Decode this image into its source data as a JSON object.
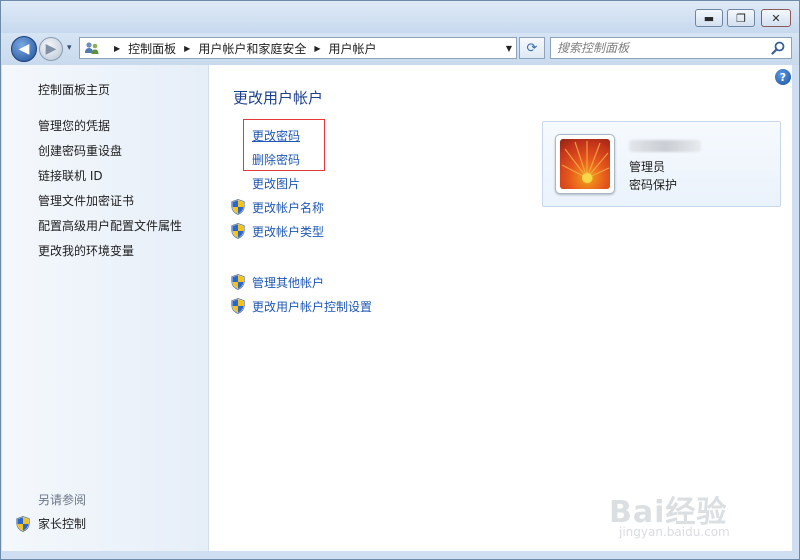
{
  "window": {
    "caption_buttons": {
      "minimize": "▬",
      "maximize": "❐",
      "close": "✕"
    }
  },
  "nav": {
    "back_glyph": "◀",
    "forward_glyph": "▶",
    "recent_glyph": "▾",
    "breadcrumb": [
      "控制面板",
      "用户帐户和家庭安全",
      "用户帐户"
    ],
    "breadcrumb_separator": "▶",
    "address_dropdown_glyph": "▼",
    "refresh_glyph": "⟳",
    "search_placeholder": "搜索控制面板"
  },
  "sidebar": {
    "home": "控制面板主页",
    "items": [
      "管理您的凭据",
      "创建密码重设盘",
      "链接联机 ID",
      "管理文件加密证书",
      "配置高级用户配置文件属性",
      "更改我的环境变量"
    ],
    "see_also_label": "另请参阅",
    "see_also_items": [
      "家长控制"
    ]
  },
  "main": {
    "title": "更改用户帐户",
    "tasks": [
      {
        "label": "更改密码",
        "shield": false
      },
      {
        "label": "删除密码",
        "shield": false
      },
      {
        "label": "更改图片",
        "shield": false
      },
      {
        "label": "更改帐户名称",
        "shield": true
      },
      {
        "label": "更改帐户类型",
        "shield": true
      }
    ],
    "other_tasks": [
      {
        "label": "管理其他帐户",
        "shield": true
      },
      {
        "label": "更改用户帐户控制设置",
        "shield": true
      }
    ],
    "help_glyph": "?"
  },
  "user_card": {
    "role": "管理员",
    "status": "密码保护"
  },
  "watermark": {
    "text": "Bai经验",
    "url": "jingyan.baidu.com"
  },
  "colors": {
    "link_blue": "#1f58b4",
    "title_blue": "#1c3f8a",
    "highlight_red": "#e23a3a",
    "sidebar_bg": "#eef3fa"
  }
}
